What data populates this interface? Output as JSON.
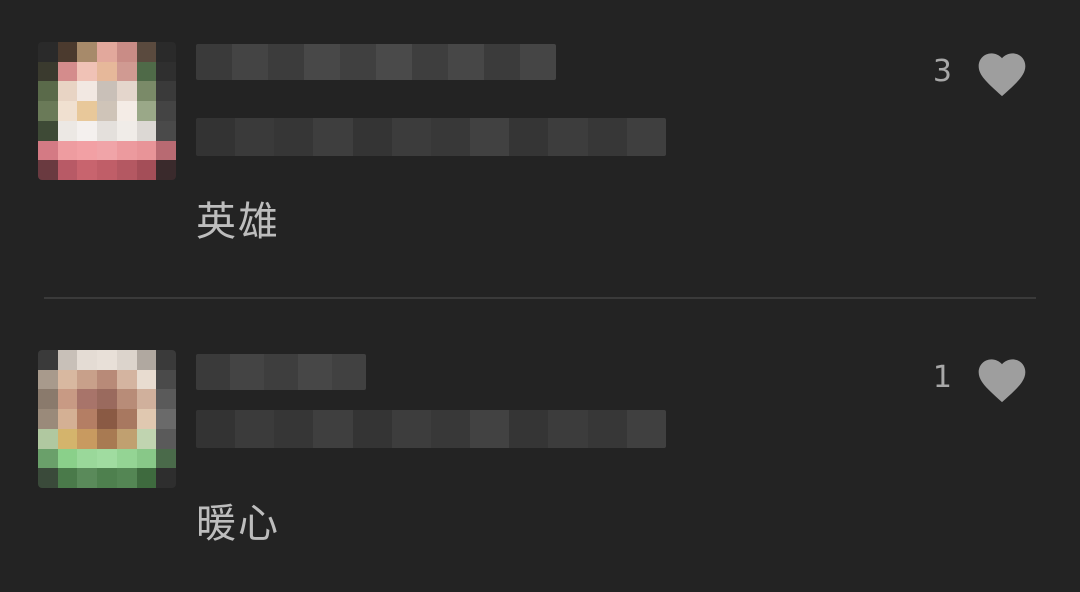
{
  "comments": [
    {
      "like_count": "3",
      "text": "英雄",
      "avatar_palette": [
        "#2a2a2a",
        "#4b3a2e",
        "#a78a6a",
        "#e2a89c",
        "#c98c86",
        "#5a4a3e",
        "#2a2a2a",
        "#3a3a2e",
        "#d48c8c",
        "#f0c2b6",
        "#e6b89a",
        "#d09a92",
        "#4f6a48",
        "#2f2f2f",
        "#5a6a4a",
        "#e8d4c4",
        "#f2e8e2",
        "#c9c0b8",
        "#e4d6cc",
        "#7a8a68",
        "#3a3a3a",
        "#6a7a58",
        "#f0e0d0",
        "#e8c89a",
        "#cfc4b8",
        "#f4ece6",
        "#9aa888",
        "#444444",
        "#3e4a36",
        "#ece8e4",
        "#f4f0ee",
        "#e4e0dc",
        "#f0ece8",
        "#dcd8d4",
        "#4a4a4a",
        "#d47a84",
        "#ee9ca0",
        "#f2a0a4",
        "#f0a4a8",
        "#ec9a9e",
        "#e89498",
        "#b86a72",
        "#6a3a40",
        "#b85a66",
        "#c8646e",
        "#c05e68",
        "#b45862",
        "#a44e58",
        "#3a2a2c"
      ],
      "name_palette": [
        "#3a3a3a",
        "#444444",
        "#3c3c3c",
        "#484848",
        "#404040",
        "#4a4a4a",
        "#3e3e3e",
        "#474747",
        "#3b3b3b",
        "#454545"
      ],
      "meta_palette": [
        "#333333",
        "#3a3a3a",
        "#363636",
        "#3e3e3e",
        "#343434",
        "#3c3c3c",
        "#383838",
        "#414141",
        "#353535",
        "#3d3d3d",
        "#373737",
        "#3f3f3f"
      ]
    },
    {
      "like_count": "1",
      "text": "暖心",
      "avatar_palette": [
        "#3a3a3a",
        "#c8c0b8",
        "#e4dcd4",
        "#e8e0d8",
        "#dcd4cc",
        "#b0a8a0",
        "#3a3a3a",
        "#a89a8c",
        "#d8b8a0",
        "#c8a08a",
        "#b88a78",
        "#d4b4a0",
        "#e8dcd0",
        "#4a4a4a",
        "#8a7a6c",
        "#c89a84",
        "#a8746a",
        "#9a6a5e",
        "#b88c78",
        "#d0b09c",
        "#5a5a5a",
        "#9a8a7a",
        "#d4b094",
        "#b47e64",
        "#8a5a44",
        "#a87860",
        "#e0c8b0",
        "#6a6a6a",
        "#b0c8a0",
        "#d4b46c",
        "#c89a60",
        "#a87a52",
        "#c0a070",
        "#c0d4b0",
        "#5a5a5a",
        "#6aa06a",
        "#8ad08a",
        "#9ad89a",
        "#a0dca0",
        "#94d494",
        "#88c888",
        "#4a6a4a",
        "#3a4a3a",
        "#4a7a4a",
        "#5a8a5a",
        "#4e804e",
        "#548654",
        "#3e6a3e",
        "#2e2e2e"
      ],
      "name_palette": [
        "#3a3a3a",
        "#444444",
        "#3e3e3e",
        "#474747",
        "#414141"
      ],
      "meta_palette": [
        "#333333",
        "#3b3b3b",
        "#363636",
        "#3f3f3f",
        "#343434",
        "#3d3d3d",
        "#383838",
        "#424242",
        "#353535",
        "#3c3c3c",
        "#373737",
        "#404040"
      ]
    }
  ],
  "colors": {
    "background": "#232323",
    "divider": "#3a3a3a",
    "text": "#bdbdbd",
    "like_count": "#a8a8a8",
    "heart": "#9e9e9e"
  },
  "icons": {
    "like": "heart-icon"
  }
}
